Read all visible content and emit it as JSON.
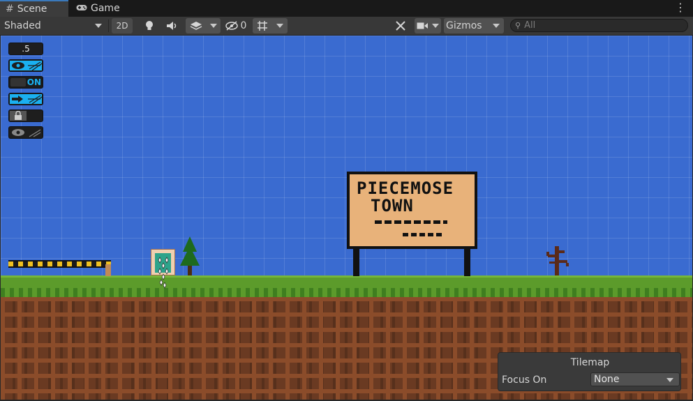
{
  "tabs": [
    {
      "label": "Scene",
      "icon": "hash-grid-icon",
      "active": true
    },
    {
      "label": "Game",
      "icon": "gamepad-icon",
      "active": false
    }
  ],
  "toolbar": {
    "shading_mode": "Shaded",
    "mode_2d_label": "2D",
    "hidden_count": "0",
    "gizmos_label": "Gizmos",
    "search_placeholder": "All"
  },
  "overlay": {
    "opacity_value": ".5",
    "toggle_label": "ON"
  },
  "sign": {
    "line1": "PIECEMOSE",
    "line2": "TOWN"
  },
  "tilemap_panel": {
    "title": "Tilemap",
    "focus_label": "Focus On",
    "focus_value": "None"
  },
  "colors": {
    "sky": "#3a6bd0",
    "grass": "#5c9b2b",
    "dirt": "#6a3a22",
    "sign_board": "#e8b27a",
    "overlay_accent": "#1ab0f0"
  }
}
